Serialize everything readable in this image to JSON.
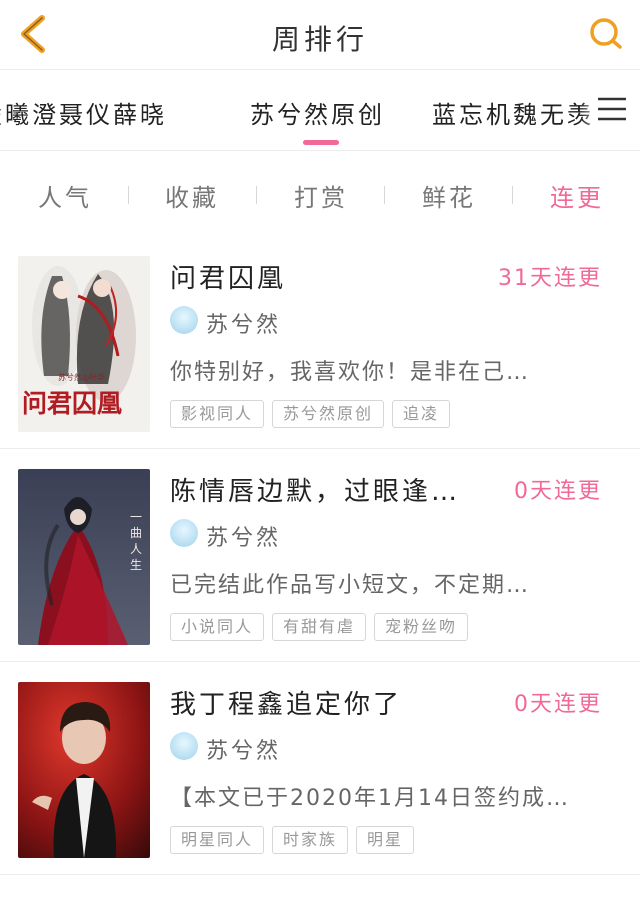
{
  "header": {
    "title": "周排行",
    "back_icon": "chevron-left-icon",
    "search_icon": "search-icon",
    "accent_color": "#f0a020"
  },
  "tabs": {
    "items": [
      {
        "label": "凌曦澄聂仪薛晓"
      },
      {
        "label": "苏兮然原创",
        "selected": true
      },
      {
        "label": "蓝忘机魏无羡"
      }
    ],
    "menu_icon": "menu-icon",
    "indicator_color": "#f06a95"
  },
  "filters": {
    "items": [
      {
        "label": "人气"
      },
      {
        "label": "收藏"
      },
      {
        "label": "打赏"
      },
      {
        "label": "鲜花"
      },
      {
        "label": "连更",
        "active": true
      }
    ],
    "active_color": "#f06a95"
  },
  "books": [
    {
      "title": "问君囚凰",
      "streak": "31天连更",
      "author": "苏兮然",
      "description": "你特别好，我喜欢你！是非在己…",
      "tags": [
        "影视同人",
        "苏兮然原创",
        "追凌"
      ],
      "cover_text": "问君囚凰",
      "cover_sub": "苏兮然◎叶华"
    },
    {
      "title": "陈情唇边默，过眼逢…",
      "streak": "0天连更",
      "author": "苏兮然",
      "description": "已完结此作品写小短文，不定期…",
      "tags": [
        "小说同人",
        "有甜有虐",
        "宠粉丝吻"
      ],
      "cover_text": "一曲人生"
    },
    {
      "title": "我丁程鑫追定你了",
      "streak": "0天连更",
      "author": "苏兮然",
      "description": "【本文已于2020年1月14日签约成…",
      "tags": [
        "明星同人",
        "时家族",
        "明星"
      ]
    }
  ]
}
